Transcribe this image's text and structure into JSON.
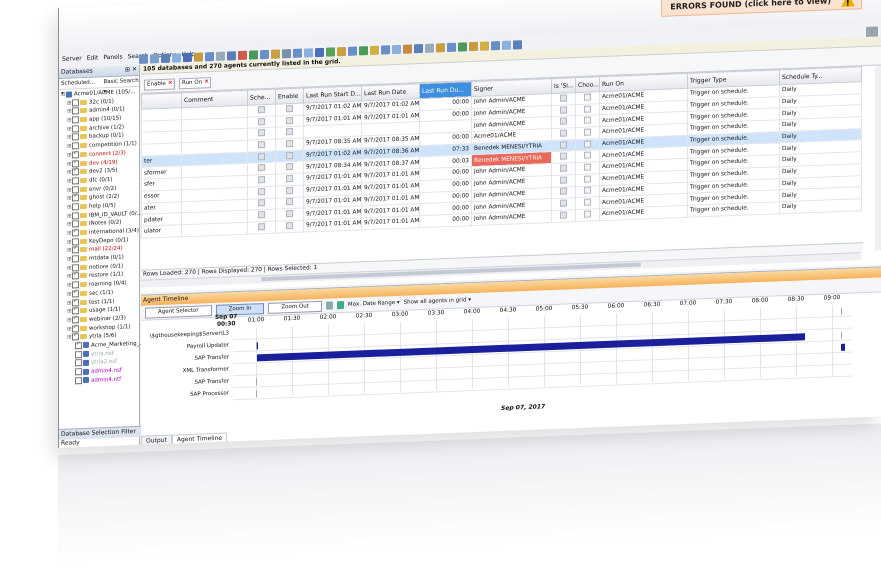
{
  "header": {
    "errors_label": "ERRORS FOUND (click here to view)",
    "menu": [
      "Server",
      "Edit",
      "Panels",
      "Search",
      "Options",
      "Help"
    ]
  },
  "sidebar": {
    "title": "Databases",
    "controls": "⊞ ✕",
    "view_dropdown": "Scheduled...",
    "search_dropdown": "Basic Search",
    "root": "Acme01/ACME (105/...",
    "items": [
      {
        "label": "32c (0/1)",
        "checked": false,
        "color": "normal"
      },
      {
        "label": "admin4 (0/1)",
        "checked": false,
        "color": "normal"
      },
      {
        "label": "app (10/15)",
        "checked": false,
        "color": "normal"
      },
      {
        "label": "archive (1/2)",
        "checked": false,
        "color": "normal"
      },
      {
        "label": "backup (0/1)",
        "checked": false,
        "color": "normal"
      },
      {
        "label": "competition (1/1)",
        "checked": false,
        "color": "normal"
      },
      {
        "label": "connect (2/3)",
        "checked": true,
        "color": "red"
      },
      {
        "label": "dev (4/19)",
        "checked": true,
        "color": "red"
      },
      {
        "label": "dev2 (3/5)",
        "checked": true,
        "color": "normal"
      },
      {
        "label": "dfc (0/1)",
        "checked": false,
        "color": "normal"
      },
      {
        "label": "envr (0/2)",
        "checked": false,
        "color": "normal"
      },
      {
        "label": "ghost (2/2)",
        "checked": true,
        "color": "normal"
      },
      {
        "label": "help (0/5)",
        "checked": false,
        "color": "normal"
      },
      {
        "label": "IBM_ID_VAULT (0/...",
        "checked": false,
        "color": "normal"
      },
      {
        "label": "INotes (0/2)",
        "checked": false,
        "color": "normal"
      },
      {
        "label": "international (3/4)",
        "checked": true,
        "color": "normal"
      },
      {
        "label": "KeyDepo (0/1)",
        "checked": false,
        "color": "normal"
      },
      {
        "label": "mail (22/24)",
        "checked": true,
        "color": "red"
      },
      {
        "label": "mtdata (0/1)",
        "checked": false,
        "color": "normal"
      },
      {
        "label": "notlore (0/1)",
        "checked": false,
        "color": "normal"
      },
      {
        "label": "restore (1/1)",
        "checked": true,
        "color": "normal"
      },
      {
        "label": "roaming (0/4)",
        "checked": false,
        "color": "normal"
      },
      {
        "label": "sec (1/1)",
        "checked": true,
        "color": "normal"
      },
      {
        "label": "test (1/1)",
        "checked": true,
        "color": "normal"
      },
      {
        "label": "usage (1/1)",
        "checked": true,
        "color": "normal"
      },
      {
        "label": "webinar (2/3)",
        "checked": true,
        "color": "normal"
      },
      {
        "label": "workshop (1/1)",
        "checked": true,
        "color": "normal"
      },
      {
        "label": "ytrla (5/6)",
        "checked": true,
        "color": "normal"
      },
      {
        "label": "Acme_Marketing_...",
        "checked": true,
        "color": "db"
      },
      {
        "label": "ytrla.nsf",
        "checked": false,
        "color": "grey"
      },
      {
        "label": "ytrla2.nsf",
        "checked": false,
        "color": "grey"
      },
      {
        "label": "admin4.nsf",
        "checked": false,
        "color": "mag"
      },
      {
        "label": "admin4.ntf",
        "checked": false,
        "color": "mag"
      }
    ],
    "db_selection_filter": "Database Selection Filter",
    "status": "Ready"
  },
  "grid": {
    "banner": "105 databases and 270 agents currently listed in the grid.",
    "filter_chips": [
      "Enable",
      "Run On"
    ],
    "columns": [
      "",
      "Comment",
      "Sche...",
      "Enable",
      "Last Run Start D...",
      "Last Run Date",
      "Last Run Du...",
      "Signer",
      "Is 'Si...",
      "Choo...",
      "Run On",
      "Trigger Type",
      "Schedule Ty..."
    ],
    "rows": [
      {
        "name": "",
        "start": "9/7/2017 01:02 AM",
        "date": "9/7/2017 01:02 AM",
        "dur": "00:00",
        "signer": "John Admin/ACME",
        "runon": "Acme01/ACME",
        "trigger": "Trigger on schedule.",
        "sched": "Daily",
        "hl": false,
        "signer_style": ""
      },
      {
        "name": "",
        "start": "9/7/2017 01:01 AM",
        "date": "9/7/2017 01:01 AM",
        "dur": "00:00",
        "signer": "John Admin/ACME",
        "runon": "Acme01/ACME",
        "trigger": "Trigger on schedule.",
        "sched": "Daily",
        "hl": false,
        "signer_style": ""
      },
      {
        "name": "",
        "start": "",
        "date": "",
        "dur": "",
        "signer": "John Admin/ACME",
        "runon": "Acme01/ACME",
        "trigger": "Trigger on schedule.",
        "sched": "Daily",
        "hl": false,
        "signer_style": ""
      },
      {
        "name": "",
        "start": "9/7/2017 08:35 AM",
        "date": "9/7/2017 08:35 AM",
        "dur": "00:00",
        "signer": "Acme01/ACME",
        "runon": "Acme01/ACME",
        "trigger": "Trigger on schedule.",
        "sched": "Daily",
        "hl": false,
        "signer_style": ""
      },
      {
        "name": "ter",
        "start": "9/7/2017 01:02 AM",
        "date": "9/7/2017 08:36 AM",
        "dur": "07:33",
        "signer": "Benedek MENESI/YTRIA",
        "runon": "Acme01/ACME",
        "trigger": "Trigger on schedule.",
        "sched": "Daily",
        "hl": true,
        "signer_style": "red"
      },
      {
        "name": "sformer",
        "start": "9/7/2017 08:34 AM",
        "date": "9/7/2017 08:37 AM",
        "dur": "00:03",
        "signer": "Benedek MENESI/YTRIA",
        "runon": "Acme01/ACME",
        "trigger": "Trigger on schedule.",
        "sched": "Daily",
        "hl": false,
        "signer_style": "red"
      },
      {
        "name": "sfer",
        "start": "9/7/2017 01:01 AM",
        "date": "9/7/2017 01:01 AM",
        "dur": "00:00",
        "signer": "John Admin/ACME",
        "runon": "Acme01/ACME",
        "trigger": "Trigger on schedule.",
        "sched": "Daily",
        "hl": false,
        "signer_style": ""
      },
      {
        "name": "essor",
        "start": "9/7/2017 01:01 AM",
        "date": "9/7/2017 01:01 AM",
        "dur": "00:00",
        "signer": "John Admin/ACME",
        "runon": "Acme01/ACME",
        "trigger": "Trigger on schedule.",
        "sched": "Daily",
        "hl": false,
        "signer_style": ""
      },
      {
        "name": "ater",
        "start": "9/7/2017 01:01 AM",
        "date": "9/7/2017 01:01 AM",
        "dur": "00:00",
        "signer": "John Admin/ACME",
        "runon": "Acme01/ACME",
        "trigger": "Trigger on schedule.",
        "sched": "Daily",
        "hl": false,
        "signer_style": ""
      },
      {
        "name": "pdater",
        "start": "9/7/2017 01:01 AM",
        "date": "9/7/2017 01:01 AM",
        "dur": "00:00",
        "signer": "John Admin/ACME",
        "runon": "Acme01/ACME",
        "trigger": "Trigger on schedule.",
        "sched": "Daily",
        "hl": false,
        "signer_style": ""
      },
      {
        "name": "ulator",
        "start": "9/7/2017 01:01 AM",
        "date": "9/7/2017 01:01 AM",
        "dur": "00:00",
        "signer": "John Admin/ACME",
        "runon": "Acme01/ACME",
        "trigger": "Trigger on schedule.",
        "sched": "Daily",
        "hl": false,
        "signer_style": ""
      }
    ],
    "status": "Rows Loaded: 270 | Rows Displayed: 270 | Rows Selected: 1"
  },
  "timeline": {
    "title": "Agent Timeline",
    "agent_selector": "Agent Selector",
    "zoom_in": "Zoom In",
    "zoom_out": "Zoom Out",
    "date_range": "Max. Date Range",
    "show_agents": "Show all agents in grid",
    "start_label_date": "Sep 07",
    "start_label_time": "00:30",
    "ticks": [
      "01:00",
      "01:30",
      "02:00",
      "02:30",
      "03:00",
      "03:30",
      "04:00",
      "04:30",
      "05:00",
      "05:30",
      "06:00",
      "06:30",
      "07:00",
      "07:30",
      "08:00",
      "08:30",
      "09:00"
    ],
    "agents": [
      "\\$gthousekeeping$Server\\L3",
      "Payroll Updater",
      "SAP Transfer",
      "XML Transformer",
      "SAP Transfer",
      "SAP Processor"
    ],
    "date_caption": "Sep 07, 2017",
    "bottom_tabs": [
      "Output",
      "Agent Timeline"
    ]
  }
}
